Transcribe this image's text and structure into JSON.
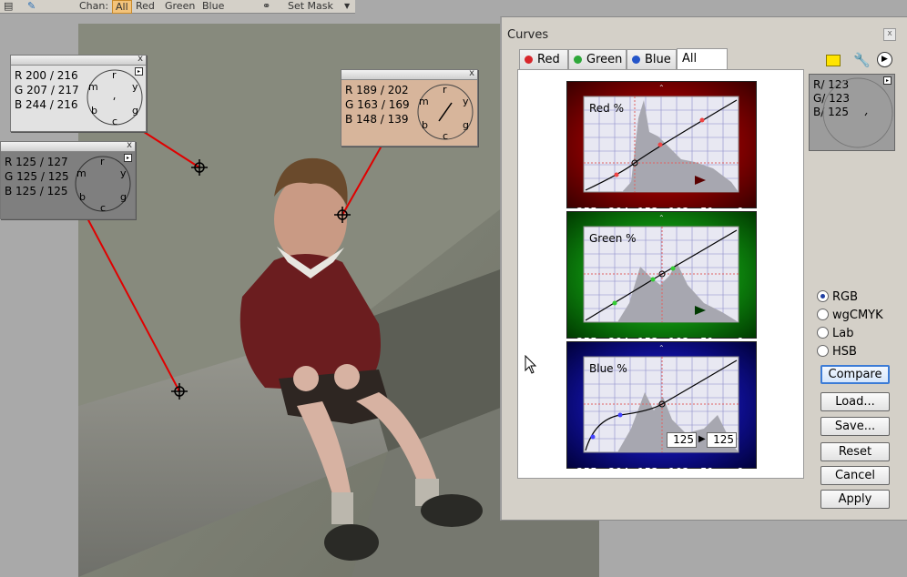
{
  "toolbar": {
    "chan_label": "Chan:",
    "chan_all": "All",
    "chan_red": "Red",
    "chan_green": "Green",
    "chan_blue": "Blue",
    "set_mask": "Set Mask"
  },
  "samplers": [
    {
      "r": "R 200 / 216",
      "g": "G 207 / 217",
      "b": "B 244 / 216",
      "bg": "#e2e2e2"
    },
    {
      "r": "R 189 / 202",
      "g": "G 163 / 169",
      "b": "B 148 / 139",
      "bg": "#d7b59b"
    },
    {
      "r": "R 125 / 127",
      "g": "G 125 / 125",
      "b": "B 125 / 125",
      "bg": "#7f7f7f"
    }
  ],
  "clock_letters": {
    "r": "r",
    "y": "y",
    "g": "g",
    "c": "c",
    "b": "b",
    "m": "m"
  },
  "curves": {
    "title": "Curves",
    "close": "x",
    "tabs": [
      {
        "label": "Red",
        "dot": "#d8262b"
      },
      {
        "label": "Green",
        "dot": "#2ea83a"
      },
      {
        "label": "Blue",
        "dot": "#2455c9"
      },
      {
        "label": "All",
        "dot": ""
      }
    ],
    "graphs": [
      {
        "label": "Red %",
        "color": "#cc1010"
      },
      {
        "label": "Green %",
        "color": "#15a015"
      },
      {
        "label": "Blue %",
        "color": "#1515b8"
      }
    ],
    "axis_labels": [
      "255",
      "204",
      "153",
      "102",
      "51",
      "0"
    ],
    "blue_input": "125",
    "blue_output": "125",
    "preview": {
      "r": "R/ 123",
      "g": "G/ 123",
      "b": "B/ 125"
    },
    "color_modes": [
      {
        "label": "RGB",
        "selected": true
      },
      {
        "label": "wgCMYK",
        "selected": false
      },
      {
        "label": "Lab",
        "selected": false
      },
      {
        "label": "HSB",
        "selected": false
      }
    ],
    "buttons": {
      "compare": "Compare",
      "load": "Load...",
      "save": "Save...",
      "reset": "Reset",
      "cancel": "Cancel",
      "apply": "Apply"
    }
  },
  "icons": [
    "document-icon",
    "eyedropper-icon",
    "link-icon",
    "sticky-note-icon",
    "wrench-icon",
    "play-icon",
    "cursor-icon"
  ]
}
